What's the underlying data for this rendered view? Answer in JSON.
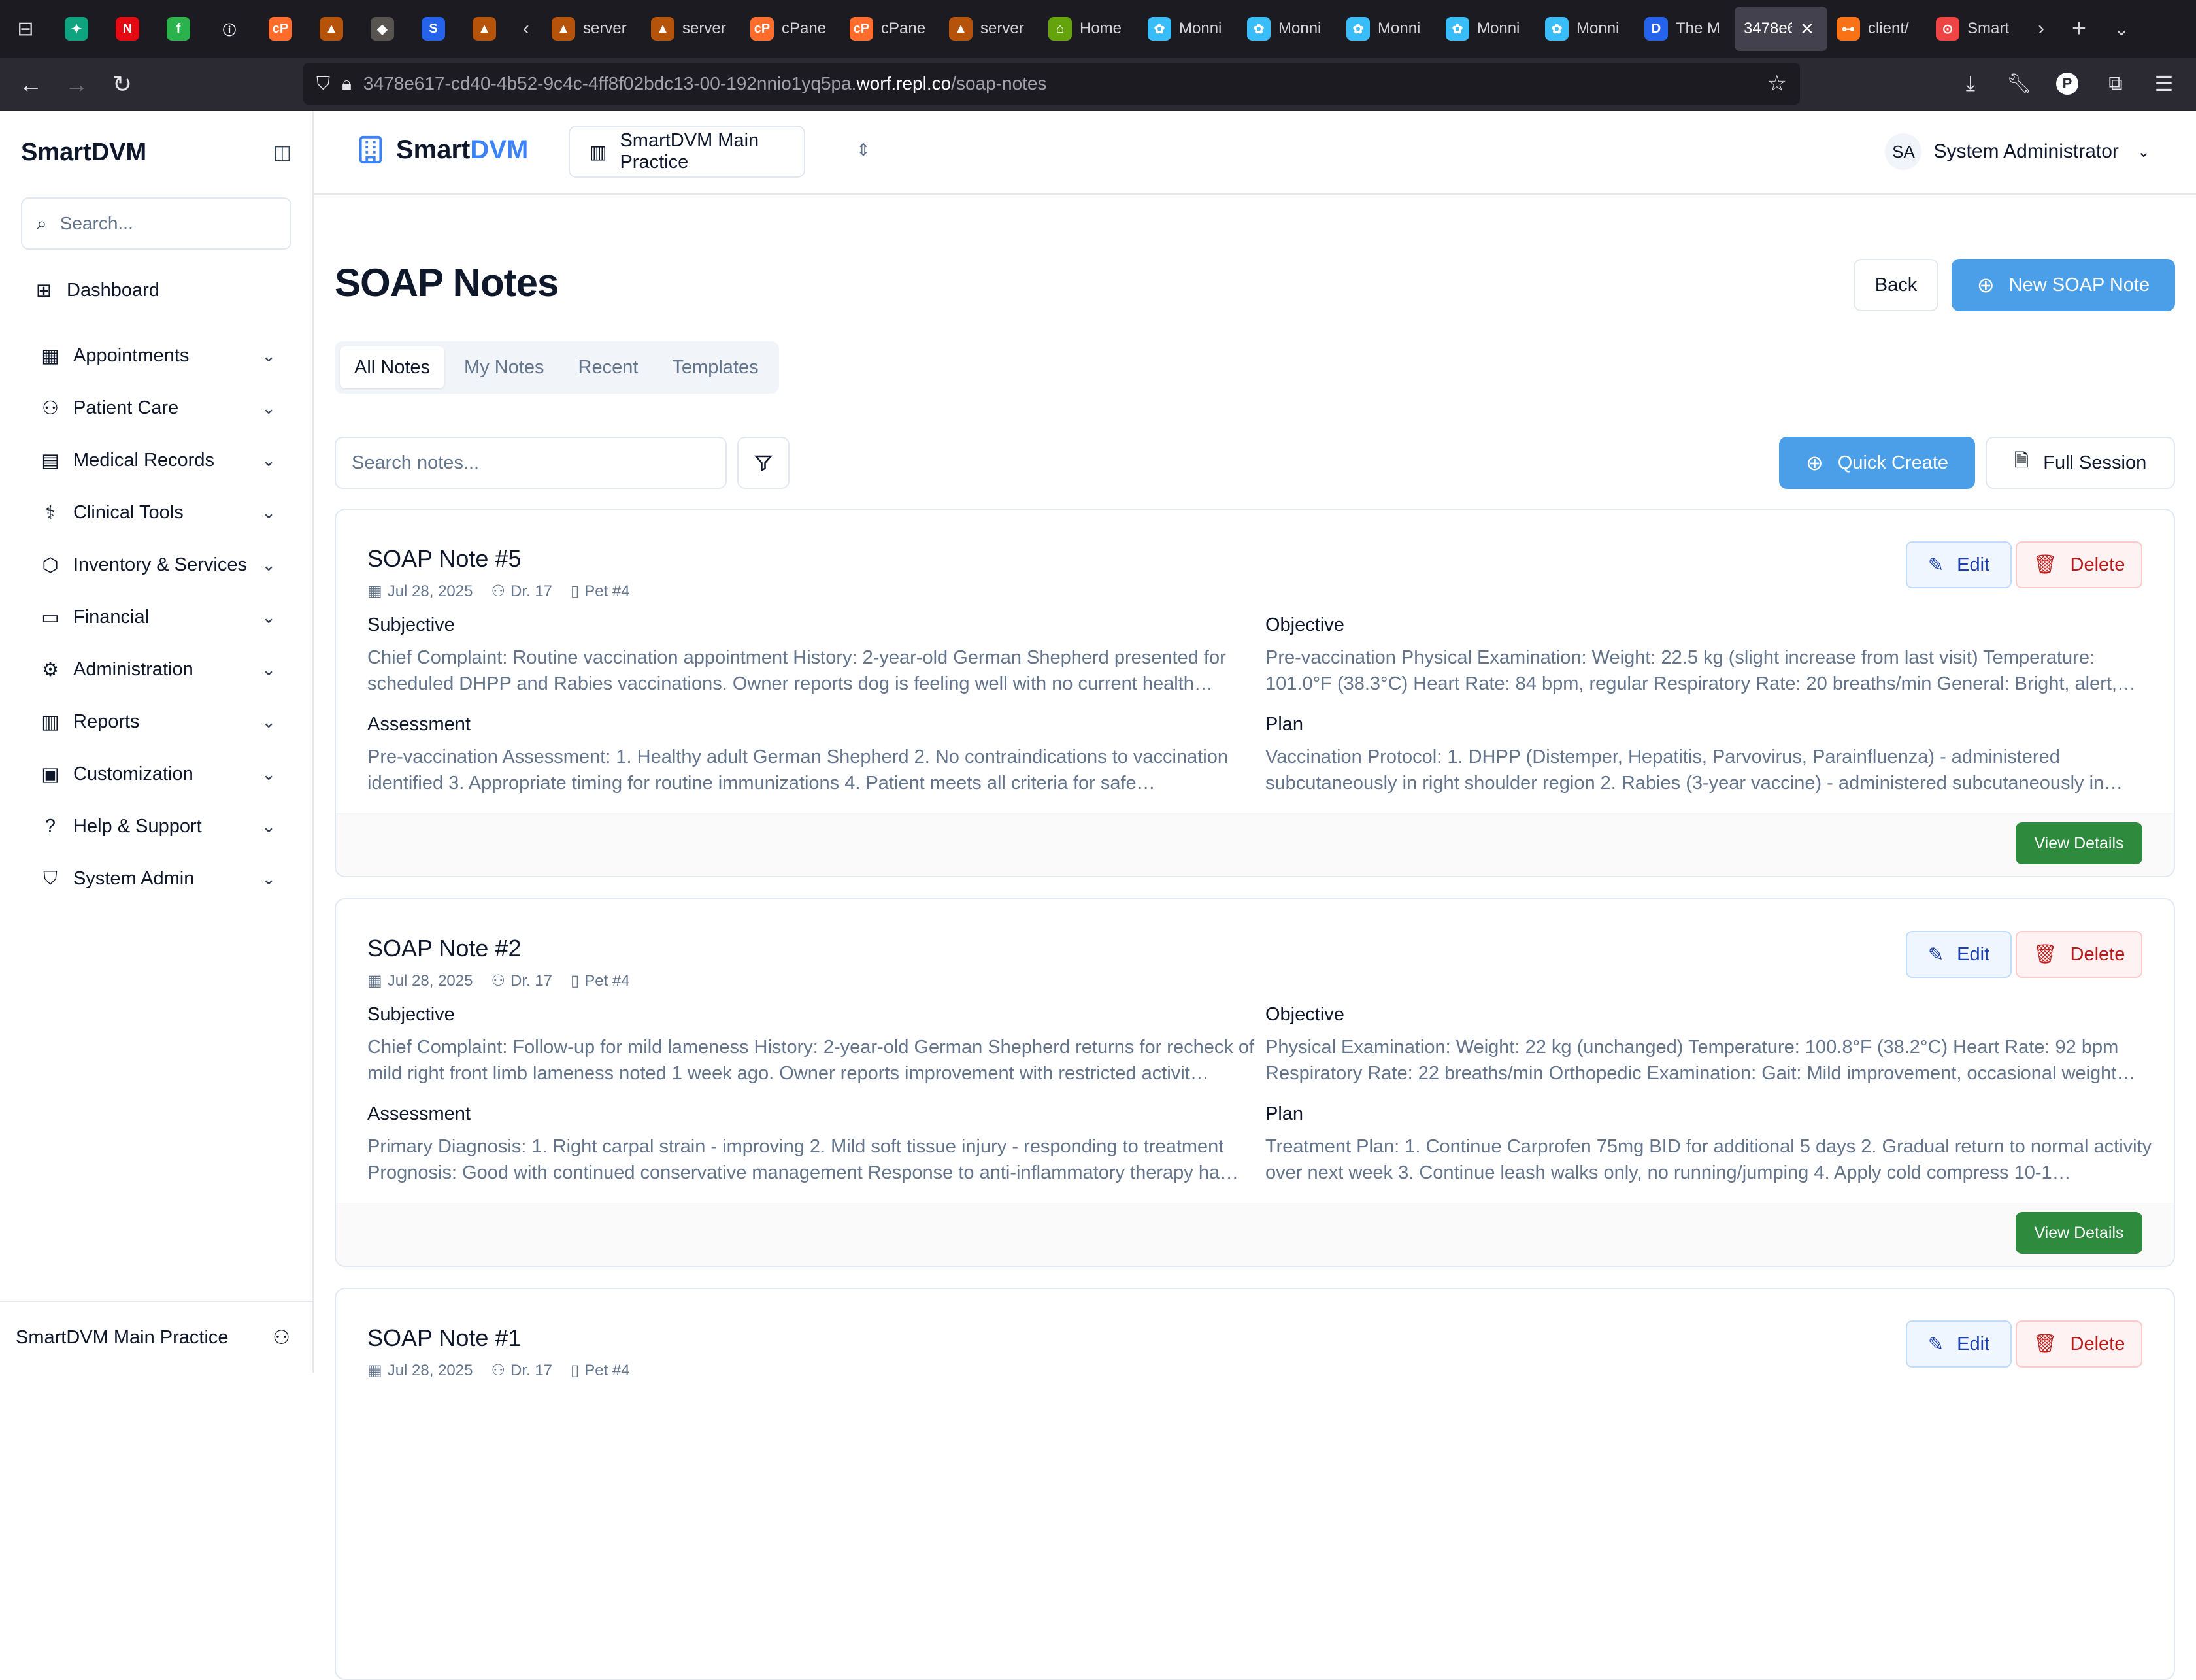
{
  "browser": {
    "tabs": [
      {
        "label": "",
        "icon": "chatgpt-icon",
        "color": "#10a37f",
        "glyph": "✦"
      },
      {
        "label": "",
        "icon": "netflix-icon",
        "color": "#e50914",
        "glyph": "N"
      },
      {
        "label": "",
        "icon": "feedly-icon",
        "color": "#2bb24c",
        "glyph": "f"
      },
      {
        "label": "",
        "icon": "info-icon",
        "color": "#1c1b22",
        "glyph": "ⓘ"
      },
      {
        "label": "",
        "icon": "cpanel-icon",
        "color": "#ff6c2c",
        "glyph": "cP"
      },
      {
        "label": "",
        "icon": "server-icon",
        "color": "#b45309",
        "glyph": "▲"
      },
      {
        "label": "",
        "icon": "puzzle-icon",
        "color": "#57534e",
        "glyph": "◆"
      },
      {
        "label": "",
        "icon": "s-icon",
        "color": "#2563eb",
        "glyph": "S"
      },
      {
        "label": "",
        "icon": "server-icon",
        "color": "#b45309",
        "glyph": "▲"
      }
    ],
    "scroll_tabs": [
      {
        "label": "server",
        "icon": "server-icon",
        "color": "#b45309",
        "glyph": "▲"
      },
      {
        "label": "server",
        "icon": "server-icon",
        "color": "#b45309",
        "glyph": "▲"
      },
      {
        "label": "cPane",
        "icon": "cpanel-icon",
        "color": "#ff6c2c",
        "glyph": "cP"
      },
      {
        "label": "cPane",
        "icon": "cpanel-icon",
        "color": "#ff6c2c",
        "glyph": "cP"
      },
      {
        "label": "server",
        "icon": "server-icon",
        "color": "#b45309",
        "glyph": "▲"
      },
      {
        "label": "Home",
        "icon": "home-icon",
        "color": "#65a30d",
        "glyph": "⌂"
      },
      {
        "label": "Monni",
        "icon": "monni-icon",
        "color": "#38bdf8",
        "glyph": "✿"
      },
      {
        "label": "Monni",
        "icon": "monni-icon",
        "color": "#38bdf8",
        "glyph": "✿"
      },
      {
        "label": "Monni",
        "icon": "monni-icon",
        "color": "#38bdf8",
        "glyph": "✿"
      },
      {
        "label": "Monni",
        "icon": "monni-icon",
        "color": "#38bdf8",
        "glyph": "✿"
      },
      {
        "label": "Monni",
        "icon": "monni-icon",
        "color": "#38bdf8",
        "glyph": "✿"
      },
      {
        "label": "The M",
        "icon": "d-icon",
        "color": "#2563eb",
        "glyph": "D"
      }
    ],
    "active_tab": "3478e6",
    "trailing_tabs": [
      {
        "label": "client/",
        "icon": "client-icon",
        "color": "#f97316",
        "glyph": "⊶"
      },
      {
        "label": "Smart",
        "icon": "smart-icon",
        "color": "#ef4444",
        "glyph": "⊙"
      }
    ],
    "url_prefix": "3478e617-cd40-4b52-9c4c-4ff8f02bdc13-00-192nnio1yq5pa.",
    "url_host": "worf.repl.co",
    "url_path": "/soap-notes"
  },
  "sidebar": {
    "title": "SmartDVM",
    "search_placeholder": "Search...",
    "items": [
      {
        "label": "Dashboard",
        "icon": "dashboard-icon",
        "glyph": "⊞",
        "chevron": false
      },
      {
        "label": "Appointments",
        "icon": "calendar-icon",
        "glyph": "▦",
        "chevron": true
      },
      {
        "label": "Patient Care",
        "icon": "users-icon",
        "glyph": "⚇",
        "chevron": true
      },
      {
        "label": "Medical Records",
        "icon": "file-medical-icon",
        "glyph": "▤",
        "chevron": true
      },
      {
        "label": "Clinical Tools",
        "icon": "stethoscope-icon",
        "glyph": "⚕",
        "chevron": true
      },
      {
        "label": "Inventory & Services",
        "icon": "package-icon",
        "glyph": "⬡",
        "chevron": true
      },
      {
        "label": "Financial",
        "icon": "credit-card-icon",
        "glyph": "▭",
        "chevron": true
      },
      {
        "label": "Administration",
        "icon": "settings-icon",
        "glyph": "⚙",
        "chevron": true
      },
      {
        "label": "Reports",
        "icon": "bar-chart-icon",
        "glyph": "▥",
        "chevron": true
      },
      {
        "label": "Customization",
        "icon": "monitor-icon",
        "glyph": "▣",
        "chevron": true
      },
      {
        "label": "Help & Support",
        "icon": "help-circle-icon",
        "glyph": "?",
        "chevron": true
      },
      {
        "label": "System Admin",
        "icon": "shield-icon",
        "glyph": "⛉",
        "chevron": true
      }
    ],
    "footer": "SmartDVM Main Practice"
  },
  "header": {
    "logo_a": "Smart",
    "logo_b": "DVM",
    "practice": "SmartDVM Main Practice",
    "user_initials": "SA",
    "user_name": "System Administrator"
  },
  "page": {
    "title": "SOAP Notes",
    "back": "Back",
    "new_note": "New SOAP Note",
    "tabs": [
      "All Notes",
      "My Notes",
      "Recent",
      "Templates"
    ],
    "active_tab": 0,
    "search_placeholder": "Search notes...",
    "quick_create": "Quick Create",
    "full_session": "Full Session",
    "labels": {
      "subjective": "Subjective",
      "objective": "Objective",
      "assessment": "Assessment",
      "plan": "Plan",
      "edit": "Edit",
      "delete": "Delete",
      "view": "View Details"
    }
  },
  "notes": [
    {
      "title": "SOAP Note #5",
      "date": "Jul 28, 2025",
      "doctor": "Dr. 17",
      "pet": "Pet #4",
      "subjective": "Chief Complaint: Routine vaccination appointment History: 2-year-old German Shepherd presented for scheduled DHPP and Rabies vaccinations. Owner reports dog is feeling well with no current health…",
      "objective": "Pre-vaccination Physical Examination: Weight: 22.5 kg (slight increase from last visit) Temperature: 101.0°F (38.3°C) Heart Rate: 84 bpm, regular Respiratory Rate: 20 breaths/min General: Bright, alert,…",
      "assessment": "Pre-vaccination Assessment: 1. Healthy adult German Shepherd 2. No contraindications to vaccination identified 3. Appropriate timing for routine immunizations 4. Patient meets all criteria for safe…",
      "plan": "Vaccination Protocol: 1. DHPP (Distemper, Hepatitis, Parvovirus, Parainfluenza) - administered subcutaneously in right shoulder region 2. Rabies (3-year vaccine) - administered subcutaneously in…"
    },
    {
      "title": "SOAP Note #2",
      "date": "Jul 28, 2025",
      "doctor": "Dr. 17",
      "pet": "Pet #4",
      "subjective": "Chief Complaint: Follow-up for mild lameness History: 2-year-old German Shepherd returns for recheck of mild right front limb lameness noted 1 week ago. Owner reports improvement with restricted activit…",
      "objective": "Physical Examination: Weight: 22 kg (unchanged) Temperature: 100.8°F (38.2°C) Heart Rate: 92 bpm Respiratory Rate: 22 breaths/min Orthopedic Examination: Gait: Mild improvement, occasional weight…",
      "assessment": "Primary Diagnosis: 1. Right carpal strain - improving 2. Mild soft tissue injury - responding to treatment Prognosis: Good with continued conservative management Response to anti-inflammatory therapy ha…",
      "plan": "Treatment Plan: 1. Continue Carprofen 75mg BID for additional 5 days 2. Gradual return to normal activity over next week 3. Continue leash walks only, no running/jumping 4. Apply cold compress 10-1…"
    },
    {
      "title": "SOAP Note #1",
      "date": "Jul 28, 2025",
      "doctor": "Dr. 17",
      "pet": "Pet #4"
    }
  ]
}
